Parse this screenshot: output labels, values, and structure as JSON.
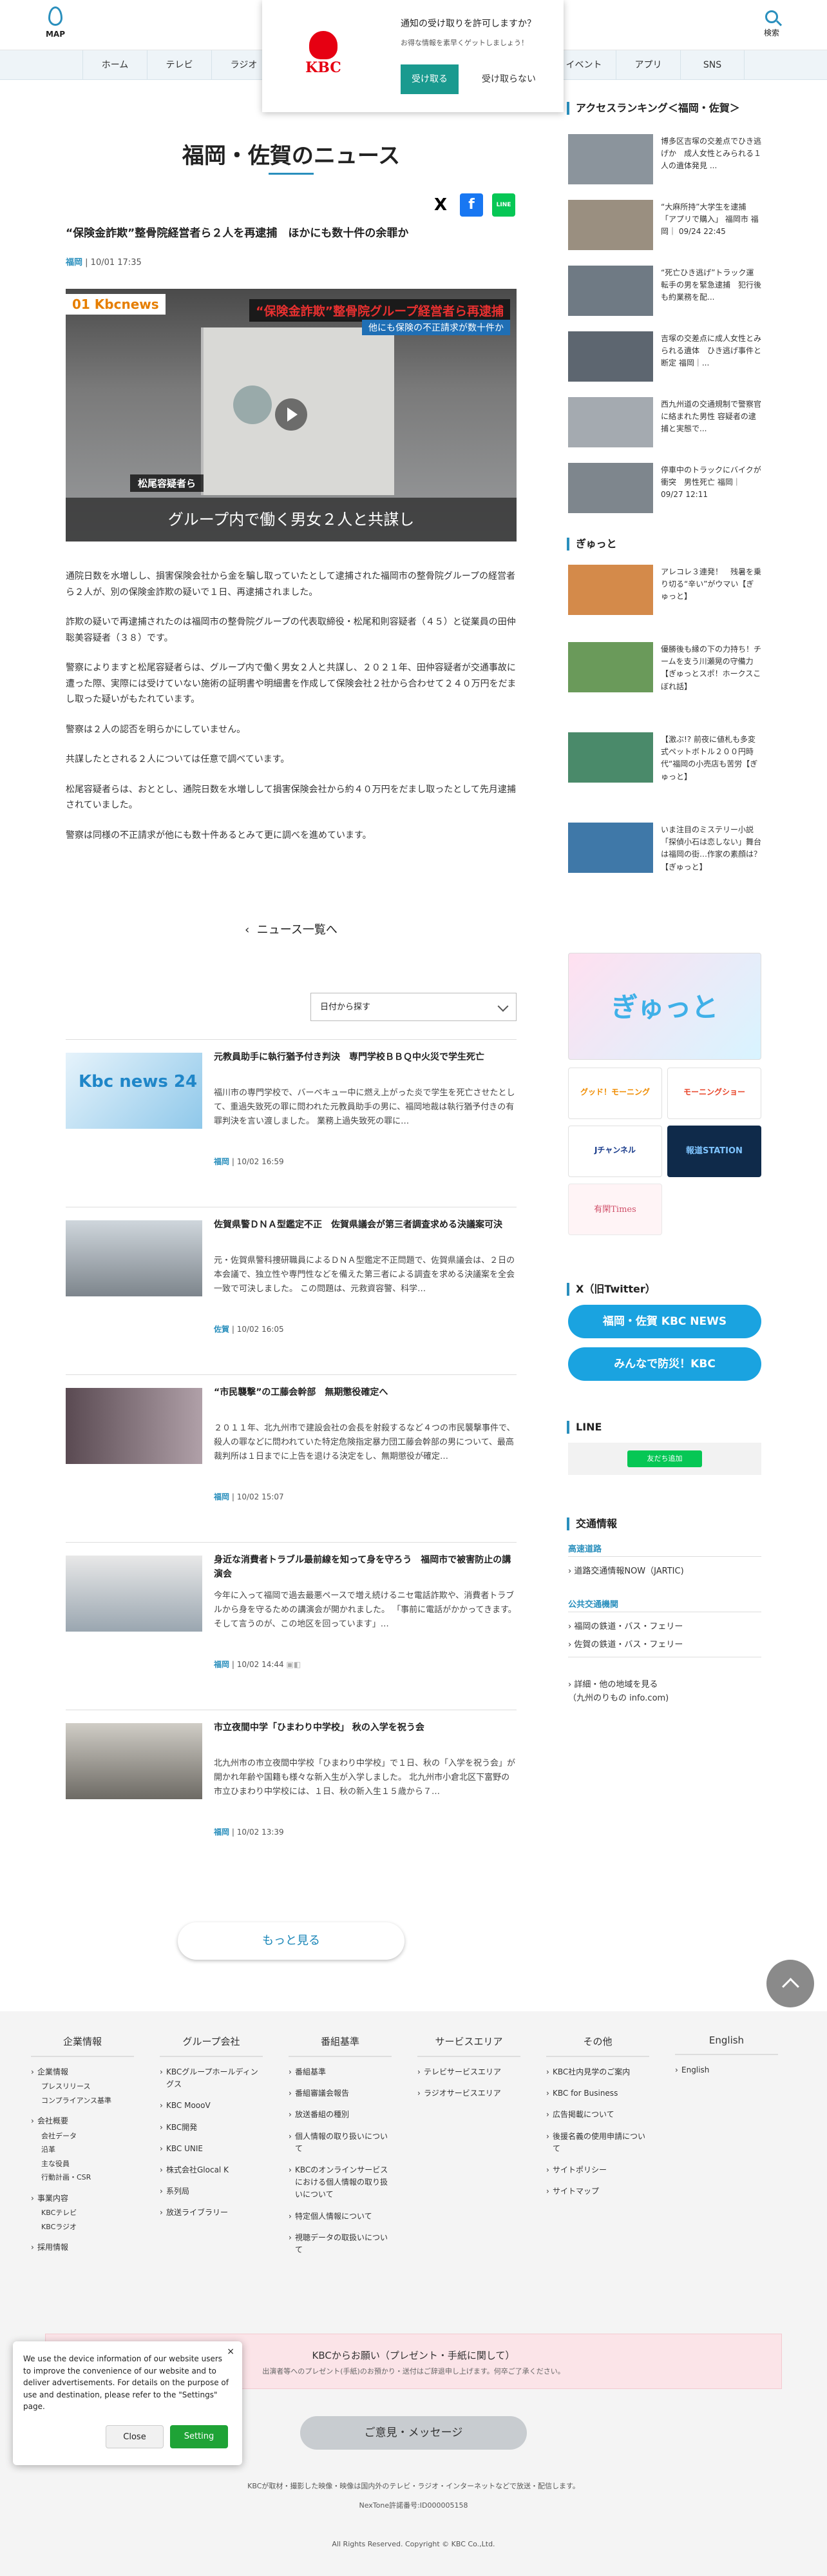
{
  "header": {
    "map_label": "MAP",
    "search_label": "検索",
    "nav": [
      "ホーム",
      "テレビ",
      "ラジオ",
      "イベント",
      "アプリ",
      "SNS"
    ]
  },
  "popup": {
    "logo": "KBC",
    "question": "通知の受け取りを許可しますか？",
    "sub": "お得な情報を素早くゲットしましょう！",
    "accept": "受け取る",
    "reject": "受け取らない"
  },
  "page": {
    "title": "福岡・佐賀のニュース"
  },
  "share": {
    "x": "X",
    "facebook": "f",
    "line": "LINE"
  },
  "article": {
    "title": "“保険金詐欺”整骨院経営者ら２人を再逮捕　ほかにも数十件の余罪か",
    "category": "福岡",
    "date": "10/01 17:35",
    "image": {
      "brand": "01 Kbcnews",
      "headline": "“保険金詐欺”整骨院グループ経営者ら再逮捕",
      "sub": "他にも保険の不正請求が数十件か",
      "location": "松尾容疑者ら",
      "caption": "グループ内で働く男女２人と共謀し"
    },
    "paragraphs": [
      "通院日数を水増しし、損害保険会社から金を騙し取っていたとして逮捕された福岡市の整骨院グループの経営者ら２人が、別の保険金詐欺の疑いで１日、再逮捕されました。",
      "詐欺の疑いで再逮捕されたのは福岡市の整骨院グループの代表取締役・松尾和則容疑者（４５）と従業員の田仲聡美容疑者（３８）です。",
      "警察によりますと松尾容疑者らは、グループ内で働く男女２人と共謀し、２０２１年、田仲容疑者が交通事故に遭った際、実際には受けていない施術の証明書や明細書を作成して保険会社２社から合わせて２４０万円をだまし取った疑いがもたれています。",
      "警察は２人の認否を明らかにしていません。",
      "共謀したとされる２人については任意で調べています。",
      "松尾容疑者らは、おととし、通院日数を水増しして損害保険会社から約４０万円をだまし取ったとして先月逮捕されていました。",
      "警察は同様の不正請求が他にも数十件あるとみて更に調べを進めています。"
    ]
  },
  "back_link": "ニュース一覧へ",
  "date_select": "日付から探す",
  "news": [
    {
      "title": "元教員助手に執行猶予付き判決　専門学校ＢＢＱ中火災で学生死亡",
      "desc": "福川市の専門学校で、バーベキュー中に燃え上がった炎で学生を死亡させたとして、重過失致死の罪に問われた元教員助手の男に、福岡地裁は執行猶予付きの有罪判決を言い渡しました。 業務上過失致死の罪に…",
      "cat": "福岡",
      "date": "10/02 16:59",
      "thumb": "Kbc news 24"
    },
    {
      "title": "佐賀県警ＤＮＡ型鑑定不正　佐賀県議会が第三者調査求める決議案可決",
      "desc": "元・佐賀県警科捜研職員によるＤＮＡ型鑑定不正問題で、佐賀県議会は、２日の本会議で、独立性や専門性などを備えた第三者による調査を求める決議案を全会一致で可決しました。 この問題は、元救資容警、科学…",
      "cat": "佐賀",
      "date": "10/02 16:05",
      "thumb": ""
    },
    {
      "title": "“市民襲撃”の工藤会幹部　無期懲役確定へ",
      "desc": "２０１１年、北九州市で建設会社の会長を射殺するなど４つの市民襲撃事件で、殺人の罪などに問われていた特定危険指定暴力団工藤会幹部の男について、最高裁判所は１日までに上告を退ける決定をし、無期懲役が確定…",
      "cat": "福岡",
      "date": "10/02 15:07",
      "thumb": ""
    },
    {
      "title": "身近な消費者トラブル最前線を知って身を守ろう　福岡市で被害防止の講演会",
      "desc": "今年に入って福岡で過去最悪ペースで増え続けるニセ電話詐欺や、消費者トラブルから身を守るための講演会が開かれました。 「事前に電話がかかってきます。そして言うのが、この地区を回っています」…",
      "cat": "福岡",
      "date": "10/02 14:44",
      "thumb": ""
    },
    {
      "title": "市立夜間中学「ひまわり中学校」 秋の入学を祝う会",
      "desc": "北九州市の市立夜間中学校「ひまわり中学校」で１日、秋の「入学を祝う会」が開かれ年齢や国籍も様々な新入生が入学しました。 北九州市小倉北区下富野の市立ひまわり中学校には、１日、秋の新入生１５歳から７…",
      "cat": "福岡",
      "date": "10/02 13:39",
      "thumb": ""
    }
  ],
  "more_button": "もっと見る",
  "sidebar": {
    "ranking_title": "アクセスランキング＜福岡・佐賀＞",
    "ranking": [
      "博多区吉塚の交差点でひき逃げか　成人女性とみられる１人の遺体発見 ...",
      "“大麻所持”大学生を逮捕「アプリで購入」 福岡市 福岡｜ 09/24 22:45",
      "“死亡ひき逃げ”トラック運転手の男を緊急逮捕　犯行後も約業務を配...",
      "吉塚の交差点に成人女性とみられる遺体　ひき逃げ事件と断定 福岡｜...",
      "西九州道の交通規制で警察官に絡まれた男性 容疑者の逮捕と実態で...",
      "停車中のトラックにバイクが衝突　男性死亡 福岡｜ 09/27 12:11"
    ],
    "gyutto_title": "ぎゅっと",
    "gyutto": [
      "アレコレ３連発！　残暑を乗り切る“辛い”がウマい【ぎゅっと】",
      "優勝後も縁の下の力持ち！チームを支う川瀬晃の守備力【ぎゅっとスポ！ホークスこぼれ話】",
      "【激ぶ!? 前夜に値札も多変式ペットボトル２００円時代“福岡の小売店も苦労【ぎゅっと】",
      "いま注目のミステリー小説「探偵小石は恋しない」舞台は福岡の街…作家の素顔は？【ぎゅっと】"
    ],
    "banners": {
      "gyutto": "ぎゅっと",
      "goodmorning": "グッド！モーニング",
      "morningshow": "モーニングショー",
      "jchannel": "Jチャンネル",
      "houdou": "報道STATION",
      "yuryo": "有閑Times"
    },
    "twitter_title": "X（旧Twitter）",
    "twitter_buttons": [
      "福岡・佐賀 KBC NEWS",
      "みんなで防災！KBC"
    ],
    "line_title": "LINE",
    "line_button": "友だち追加",
    "traffic_title": "交通情報",
    "traffic": {
      "road_head": "高速道路",
      "road_link": "道路交通情報NOW（JARTIC)",
      "public_head": "公共交通機関",
      "links": [
        "福岡の鉄道・バス・フェリー",
        "佐賀の鉄道・バス・フェリー"
      ],
      "detail": "詳細・他の地域を見る\n（九州のりもの info.com)"
    }
  },
  "footer": {
    "cols": [
      {
        "head": "企業情報",
        "items": [
          "企業情報",
          "会社概要",
          "事業内容",
          "採用情報"
        ]
      },
      {
        "head": "グループ会社",
        "items": [
          "KBCグループホールディングス",
          "KBC MoooV",
          "KBC開発",
          "KBC UNIE",
          "株式会社Glocal K",
          "系列局",
          "放送ライブラリー"
        ]
      },
      {
        "head": "番組基準",
        "items": [
          "番組基準",
          "番組審議会報告",
          "放送番組の種別",
          "個人情報の取り扱いについて",
          "KBCのオンラインサービスにおける個人情報の取り扱いについて",
          "特定個人情報について",
          "視聴データの取扱いについて"
        ]
      },
      {
        "head": "サービスエリア",
        "items": [
          "テレビサービスエリア",
          "ラジオサービスエリア"
        ]
      },
      {
        "head": "その他",
        "items": [
          "KBC社内見学のご案内",
          "KBC for Business",
          "広告掲載について",
          "後援名義の使用申請について",
          "サイトポリシー",
          "サイトマップ"
        ]
      },
      {
        "head": "English",
        "items": [
          "English"
        ]
      }
    ],
    "sub_company": [
      "プレスリリース",
      "コンプライアンス基準"
    ],
    "sub_overview": [
      "会社データ",
      "沿革",
      "主な役員",
      "行動計画・CSR"
    ],
    "sub_business": [
      "KBCテレビ",
      "KBCラジオ"
    ],
    "notice_title": "KBCからお願い（プレゼント・手紙に関して）",
    "notice_text": "出演者等へのプレゼント(手紙)のお預かり・送付はご辞退申し上げます。何卒ご了承ください。",
    "opinion": "ご意見・メッセージ",
    "copy1": "KBCが取材・撮影した映像・映像は国内外のテレビ・ラジオ・インターネットなどで放送・配信します。",
    "copy2": "NexTone許諾番号:ID000005158",
    "copyright": "All Rights Reserved. Copyright © KBC Co.,Ltd."
  },
  "cookie": {
    "text": "We use the device information of our website users to improve the convenience of our website and to deliver advertisements. For details on the purpose of use and destination, please refer to the \"Settings\" page.",
    "close": "Close",
    "setting": "Setting"
  }
}
